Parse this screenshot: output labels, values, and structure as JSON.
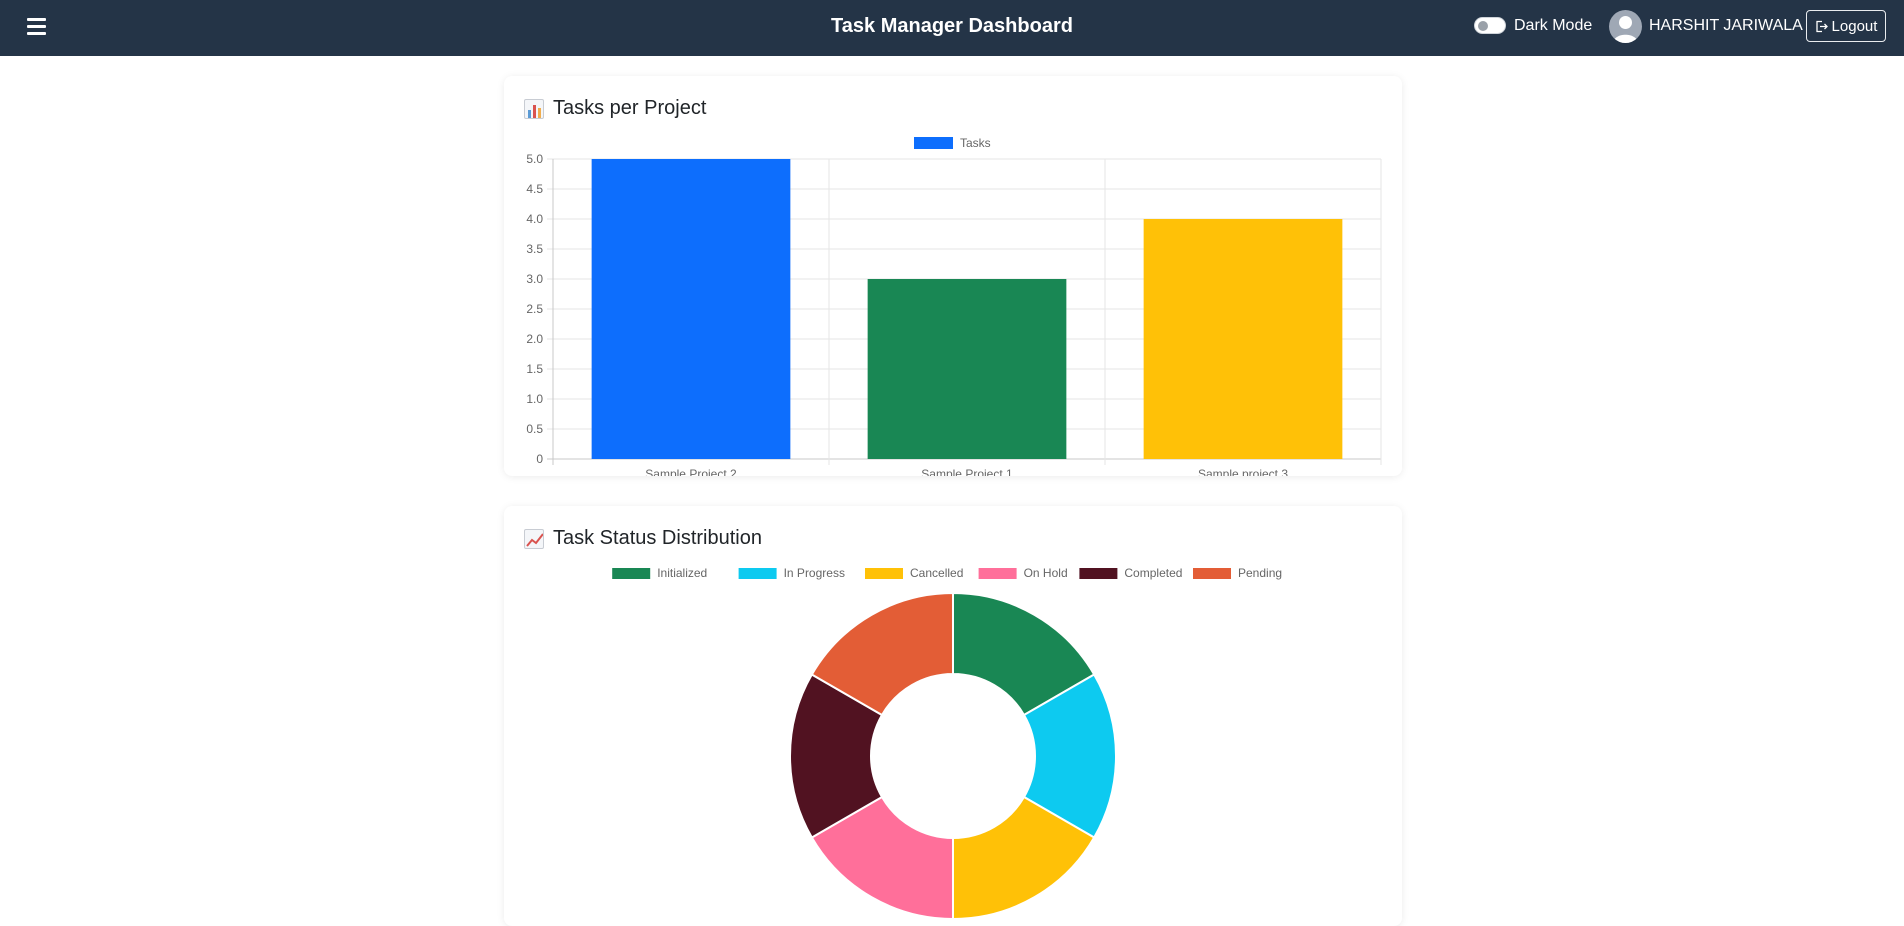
{
  "header": {
    "title": "Task Manager Dashboard",
    "dark_mode_label": "Dark Mode",
    "user_name": "HARSHIT JARIWALA",
    "logout_label": "Logout"
  },
  "cards": {
    "bar_title": "Tasks per Project",
    "pie_title": "Task Status Distribution"
  },
  "chart_data": [
    {
      "type": "bar",
      "title": "Tasks per Project",
      "categories": [
        "Sample Project 2",
        "Sample Project 1",
        "Sample project 3"
      ],
      "series": [
        {
          "name": "Tasks",
          "values": [
            5,
            3,
            4
          ]
        }
      ],
      "colors": [
        "#0d6efd",
        "#198754",
        "#ffc107"
      ],
      "legend_color": "#0d6efd",
      "ylim": [
        0,
        5
      ],
      "yticks": [
        "0",
        "0.5",
        "1.0",
        "1.5",
        "2.0",
        "2.5",
        "3.0",
        "3.5",
        "4.0",
        "4.5",
        "5.0"
      ],
      "grid": true,
      "legend": "top"
    },
    {
      "type": "pie",
      "variant": "doughnut",
      "title": "Task Status Distribution",
      "labels": [
        "Initialized",
        "In Progress",
        "Cancelled",
        "On Hold",
        "Completed",
        "Pending"
      ],
      "values": [
        1,
        1,
        1,
        1,
        1,
        1
      ],
      "colors": [
        "#198754",
        "#0dcaf0",
        "#ffc107",
        "#ff6f9a",
        "#511221",
        "#e35d36"
      ],
      "legend": "top"
    }
  ]
}
